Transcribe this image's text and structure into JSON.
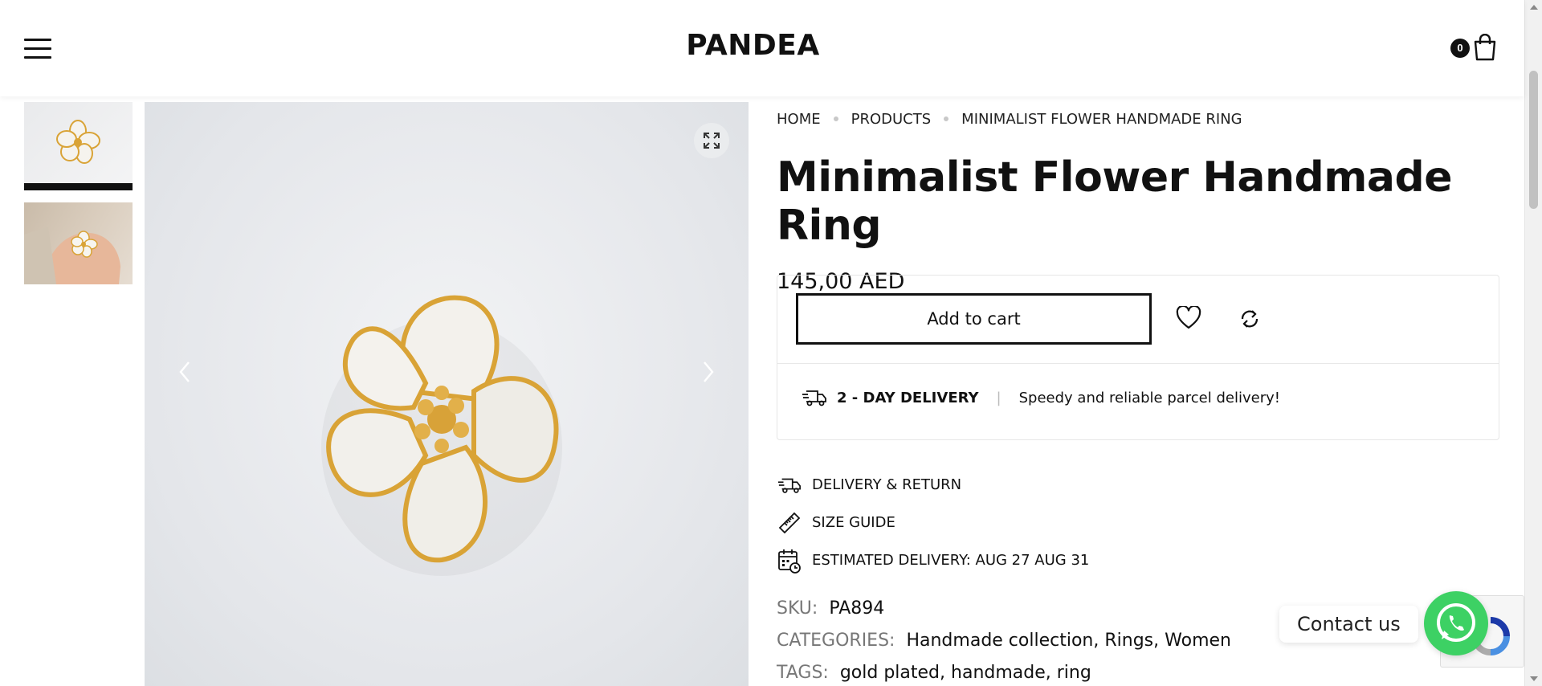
{
  "header": {
    "brand": "PANDEA",
    "cart_count": "0",
    "menu_icon": "hamburger-icon",
    "cart_icon": "shopping-bag-icon"
  },
  "gallery": {
    "thumbnails": [
      {
        "alt": "flower-ring-thumbnail",
        "active": true
      },
      {
        "alt": "flower-ring-on-hand-thumbnail",
        "active": false
      }
    ],
    "zoom_icon": "expand-icon",
    "prev_icon": "chevron-left-icon",
    "next_icon": "chevron-right-icon"
  },
  "breadcrumb": [
    "HOME",
    "PRODUCTS",
    "MINIMALIST FLOWER HANDMADE RING"
  ],
  "product": {
    "title": "Minimalist Flower Handmade Ring",
    "price": "145,00 AED",
    "add_to_cart": "Add to cart",
    "wishlist_icon": "heart-icon",
    "compare_icon": "refresh-icon"
  },
  "delivery": {
    "label": "2 - DAY DELIVERY",
    "separator": "|",
    "description": "Speedy and reliable parcel delivery!"
  },
  "links": [
    {
      "label": "DELIVERY & RETURN",
      "icon": "truck-icon"
    },
    {
      "label": "SIZE GUIDE",
      "icon": "ruler-icon"
    },
    {
      "label": "ESTIMATED DELIVERY: AUG 27 AUG 31",
      "icon": "calendar-clock-icon"
    }
  ],
  "meta": {
    "sku_label": "SKU:",
    "sku": "PA894",
    "categories_label": "CATEGORIES:",
    "categories": [
      "Handmade collection",
      "Rings",
      "Women"
    ],
    "tags_label": "TAGS:",
    "tags": [
      "gold plated",
      "handmade",
      "ring"
    ]
  },
  "contact": {
    "label": "Contact us",
    "icon": "whatsapp-icon"
  },
  "colors": {
    "accent": "#111111",
    "whatsapp": "#3dd164",
    "gold": "#d9a336"
  }
}
